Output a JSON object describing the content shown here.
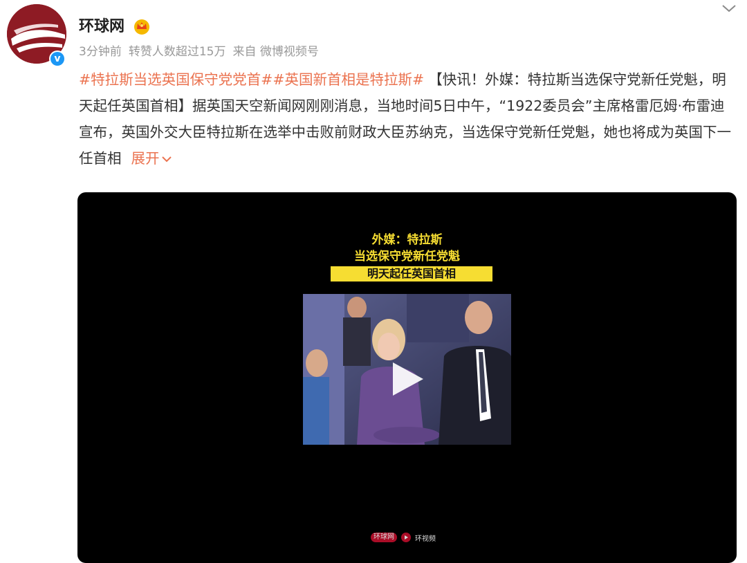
{
  "user": {
    "name": "环球网",
    "verified_glyph": "v",
    "avatar_icon": "globe-newspaper-logo",
    "badge_icon": "crown-icon"
  },
  "meta": {
    "time": "3分钟前",
    "reposts": "转赞人数超过15万",
    "source": "来自 微博视频号"
  },
  "post": {
    "hashtag_1": "#特拉斯当选英国保守党党首#",
    "hashtag_2": "#英国新首相是特拉斯#",
    "body": "【快讯！外媒：特拉斯当选保守党新任党魁，明天起任英国首相】据英国天空新闻网刚刚消息，当地时间5日中午，“1922委员会”主席格雷厄姆·布雷迪宣布，英国外交大臣特拉斯在选举中击败前财政大臣苏纳克，当选保守党新任党魁，她也将成为英国下一任首相",
    "expand_label": "展开"
  },
  "video": {
    "caption_line1": "外媒：特拉斯",
    "caption_line2": "当选保守党新任党魁",
    "caption_line3": "明天起任英国首相",
    "watermark_1": "环球网",
    "watermark_2": "环视频",
    "play_icon": "play-icon"
  },
  "colors": {
    "accent": "#eb7350",
    "caption_yellow": "#f6dd32",
    "brand_red": "#8e1b24",
    "verified_blue": "#1c97f5"
  }
}
